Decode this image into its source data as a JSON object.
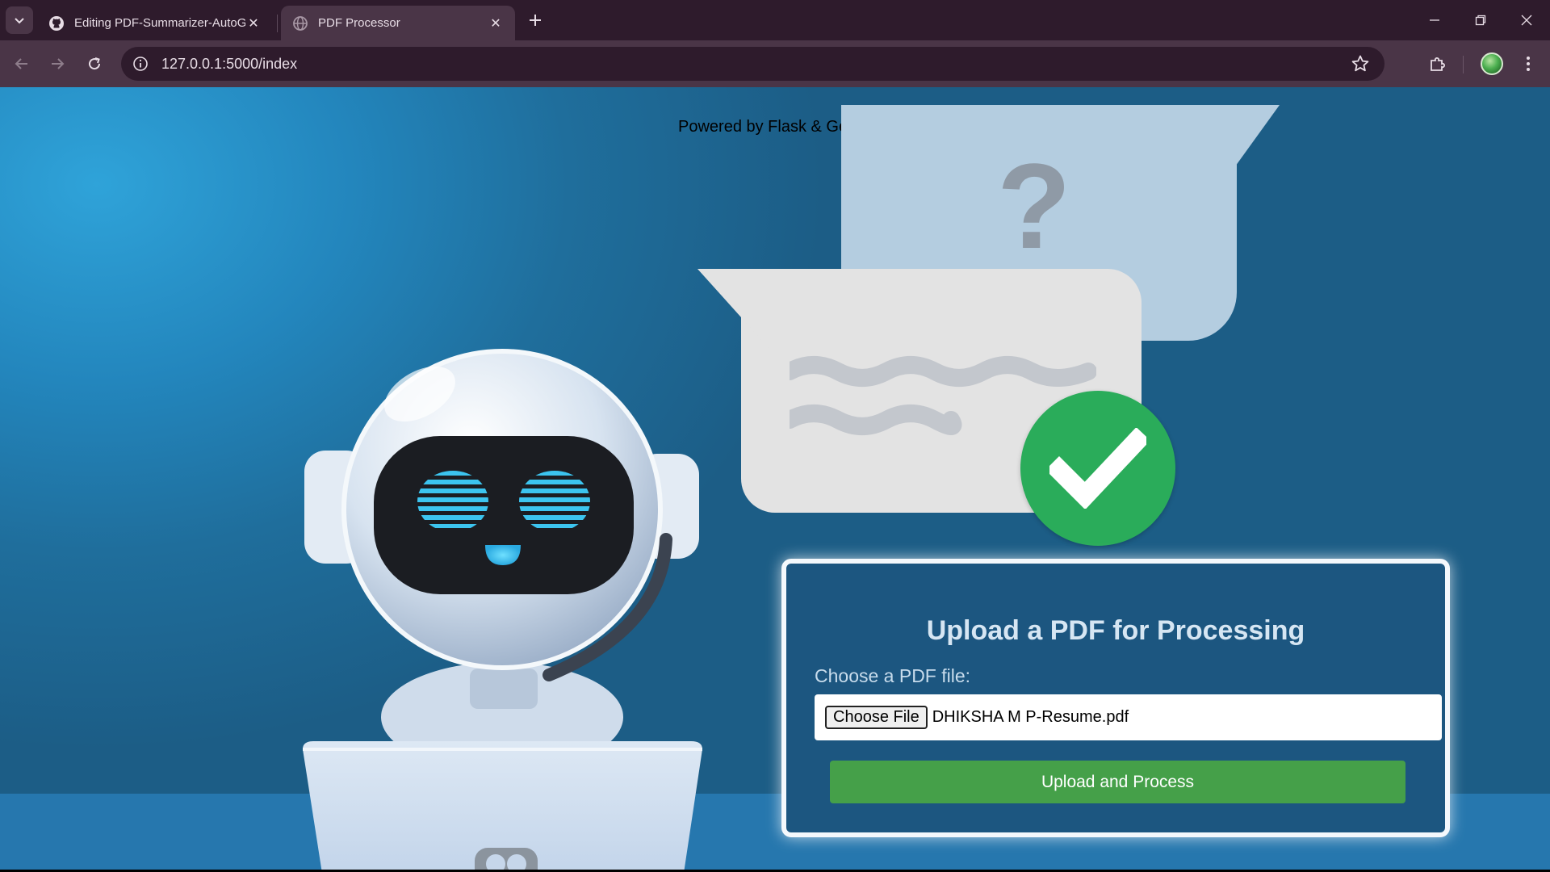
{
  "browser": {
    "tabs": [
      {
        "title": "Editing PDF-Summarizer-AutoG",
        "favicon": "github-icon",
        "active": false
      },
      {
        "title": "PDF Processor",
        "favicon": "globe-icon",
        "active": true
      }
    ],
    "url": "127.0.0.1:5000/index"
  },
  "page": {
    "powered_by": "Powered by Flask & GenAI",
    "illustration": {
      "question_mark": "?",
      "colors": {
        "check": "#2aac5a",
        "eye": "#3cc4ef",
        "bubble_back": "#b4cde0",
        "bubble_front": "#e3e3e3"
      }
    },
    "upload": {
      "heading": "Upload a PDF for Processing",
      "file_label": "Choose a PDF file:",
      "choose_button": "Choose File",
      "selected_file": "DHIKSHA M P-Resume.pdf",
      "submit_label": "Upload and Process",
      "colors": {
        "panel": "#1c5680",
        "submit": "#45a049"
      }
    }
  }
}
